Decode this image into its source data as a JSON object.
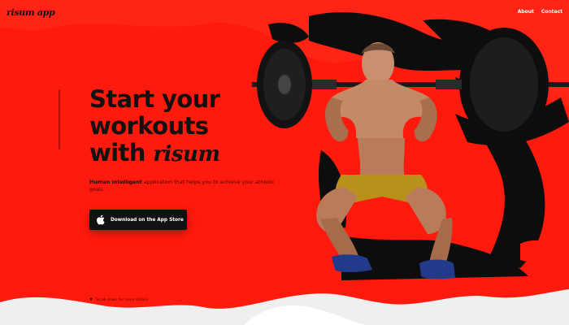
{
  "header": {
    "logo": "risum app",
    "nav": [
      "About",
      "Contact"
    ]
  },
  "hero": {
    "title_line1": "Start your",
    "title_line2": "workouts",
    "title_line3_prefix": "with",
    "brand_script": "risum",
    "desc_bold": "Human intelligent",
    "desc_rest": " application that helps you to achieve your athletic goals.",
    "cta_label": "Download on the App Store"
  },
  "footer": {
    "scroll_hint": "Scroll down for more details"
  },
  "colors": {
    "background": "#ff1a0d",
    "text_dark": "#111111",
    "cta_bg": "#111111",
    "cta_text": "#ffffff"
  },
  "icons": [
    "apple-icon",
    "scroll-down-arrow-icon"
  ]
}
